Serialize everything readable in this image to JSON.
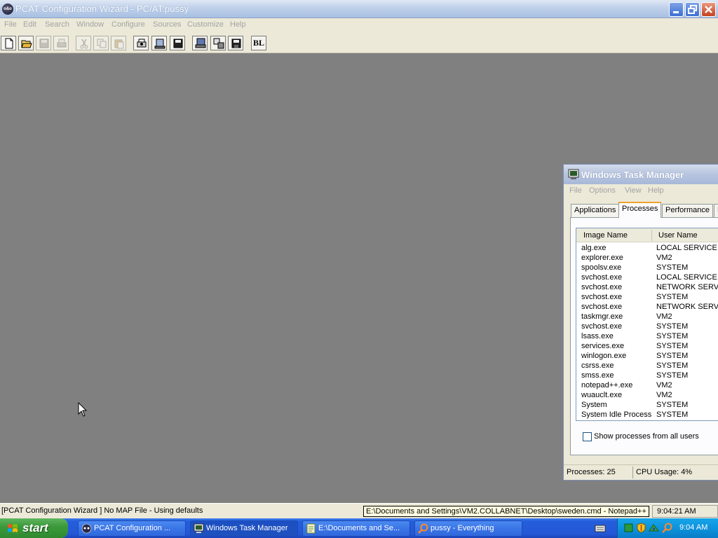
{
  "app": {
    "title": "PCAT Configuration Wizard  - PC/AT:pussy",
    "icon_text": "o&o",
    "menu": [
      "File",
      "Edit",
      "Search",
      "Window",
      "Configure",
      "Sources",
      "Customize",
      "Help"
    ],
    "toolbar": {
      "icons": [
        "new-file-icon",
        "open-folder-icon",
        "save-icon",
        "print-icon",
        "cut-icon",
        "copy-icon",
        "paste-icon",
        "process-icon",
        "device-icon",
        "disk-icon",
        "monitor-icon",
        "transfer-icon",
        "floppy-icon"
      ],
      "bl_label": "BL"
    },
    "status": {
      "left": "[PCAT Configuration Wizard ] No MAP File - Using defaults",
      "tooltip": "E:\\Documents and Settings\\VM2.COLLABNET\\Desktop\\sweden.cmd - Notepad++",
      "time": "9:04:21 AM"
    }
  },
  "task_manager": {
    "title": "Windows Task Manager",
    "menu": [
      "File",
      "Options",
      "View",
      "Help"
    ],
    "tabs": [
      "Applications",
      "Processes",
      "Performance",
      "N"
    ],
    "active_tab": "Processes",
    "columns": [
      "Image Name",
      "User Name"
    ],
    "processes": [
      {
        "name": "alg.exe",
        "user": "LOCAL SERVICE"
      },
      {
        "name": "explorer.exe",
        "user": "VM2"
      },
      {
        "name": "spoolsv.exe",
        "user": "SYSTEM"
      },
      {
        "name": "svchost.exe",
        "user": "LOCAL SERVICE"
      },
      {
        "name": "svchost.exe",
        "user": "NETWORK SERVI"
      },
      {
        "name": "svchost.exe",
        "user": "SYSTEM"
      },
      {
        "name": "svchost.exe",
        "user": "NETWORK SERVI"
      },
      {
        "name": "taskmgr.exe",
        "user": "VM2"
      },
      {
        "name": "svchost.exe",
        "user": "SYSTEM"
      },
      {
        "name": "lsass.exe",
        "user": "SYSTEM"
      },
      {
        "name": "services.exe",
        "user": "SYSTEM"
      },
      {
        "name": "winlogon.exe",
        "user": "SYSTEM"
      },
      {
        "name": "csrss.exe",
        "user": "SYSTEM"
      },
      {
        "name": "smss.exe",
        "user": "SYSTEM"
      },
      {
        "name": "notepad++.exe",
        "user": "VM2"
      },
      {
        "name": "wuauclt.exe",
        "user": "VM2"
      },
      {
        "name": "System",
        "user": "SYSTEM"
      },
      {
        "name": "System Idle Process",
        "user": "SYSTEM"
      }
    ],
    "show_all_users_label": "Show processes from all users",
    "show_all_users_checked": false,
    "status_processes": "Processes: 25",
    "status_cpu": "CPU Usage: 4%"
  },
  "taskbar": {
    "start_label": "start",
    "tasks": [
      {
        "label": "PCAT Configuration ...",
        "icon": "pcat-icon",
        "active": false
      },
      {
        "label": "Windows Task Manager",
        "icon": "task-manager-icon",
        "active": true
      },
      {
        "label": "E:\\Documents and Se...",
        "icon": "notepad-icon",
        "active": false
      },
      {
        "label": "pussy - Everything",
        "icon": "search-icon",
        "active": false
      }
    ],
    "tray_icons": [
      "green-square-icon",
      "security-shield-icon",
      "network-icon",
      "search-icon"
    ],
    "clock": "9:04 AM"
  },
  "colors": {
    "xp_blue": "#245edb",
    "start_green": "#3c9a3c",
    "tray_blue": "#0c8ed9",
    "window_face": "#ece9d8",
    "desktop_gray": "#808080"
  }
}
